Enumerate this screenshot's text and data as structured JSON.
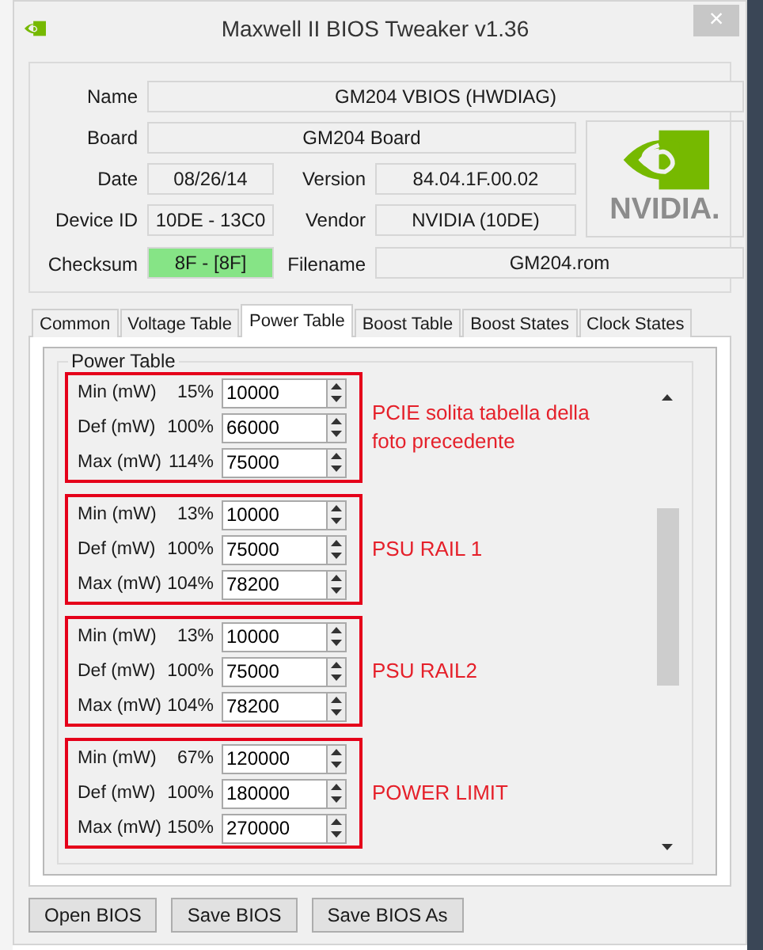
{
  "window": {
    "title": "Maxwell II BIOS Tweaker v1.36",
    "close": "×"
  },
  "info": {
    "name": {
      "label": "Name",
      "value": "GM204 VBIOS (HWDIAG)"
    },
    "board": {
      "label": "Board",
      "value": "GM204 Board"
    },
    "date": {
      "label": "Date",
      "value": "08/26/14"
    },
    "version": {
      "label": "Version",
      "value": "84.04.1F.00.02"
    },
    "device_id": {
      "label": "Device ID",
      "value": "10DE - 13C0"
    },
    "vendor": {
      "label": "Vendor",
      "value": "NVIDIA (10DE)"
    },
    "checksum": {
      "label": "Checksum",
      "value": "8F - [8F]",
      "valid": true
    },
    "filename": {
      "label": "Filename",
      "value": "GM204.rom"
    },
    "logo_text": "NVIDIA."
  },
  "tabs": [
    {
      "label": "Common",
      "selected": false
    },
    {
      "label": "Voltage Table",
      "selected": false
    },
    {
      "label": "Power Table",
      "selected": true
    },
    {
      "label": "Boost Table",
      "selected": false
    },
    {
      "label": "Boost States",
      "selected": false
    },
    {
      "label": "Clock States",
      "selected": false
    }
  ],
  "power_table": {
    "title": "Power Table",
    "groups": [
      {
        "annotation": "PCIE solita tabella della foto precedente",
        "rows": [
          {
            "label": "Min (mW)",
            "percent": "15%",
            "value": "10000"
          },
          {
            "label": "Def (mW)",
            "percent": "100%",
            "value": "66000"
          },
          {
            "label": "Max (mW)",
            "percent": "114%",
            "value": "75000"
          }
        ]
      },
      {
        "annotation": "PSU RAIL 1",
        "rows": [
          {
            "label": "Min (mW)",
            "percent": "13%",
            "value": "10000"
          },
          {
            "label": "Def (mW)",
            "percent": "100%",
            "value": "75000"
          },
          {
            "label": "Max (mW)",
            "percent": "104%",
            "value": "78200"
          }
        ]
      },
      {
        "annotation": "PSU RAIL2",
        "rows": [
          {
            "label": "Min (mW)",
            "percent": "13%",
            "value": "10000"
          },
          {
            "label": "Def (mW)",
            "percent": "100%",
            "value": "75000"
          },
          {
            "label": "Max (mW)",
            "percent": "104%",
            "value": "78200"
          }
        ]
      },
      {
        "annotation": "POWER LIMIT",
        "rows": [
          {
            "label": "Min (mW)",
            "percent": "67%",
            "value": "120000"
          },
          {
            "label": "Def (mW)",
            "percent": "100%",
            "value": "180000"
          },
          {
            "label": "Max (mW)",
            "percent": "150%",
            "value": "270000"
          }
        ]
      }
    ]
  },
  "buttons": [
    "Open BIOS",
    "Save BIOS",
    "Save BIOS As"
  ]
}
